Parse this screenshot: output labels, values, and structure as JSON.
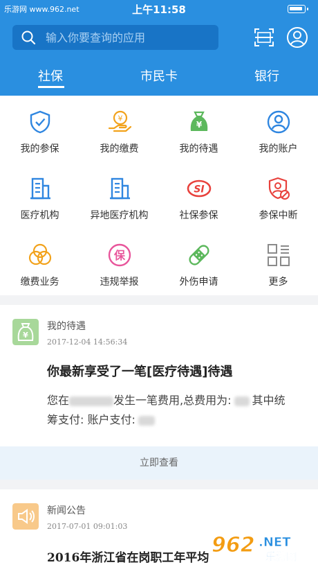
{
  "status_bar": {
    "watermark": "乐游网 www.962.net",
    "time": "上午11:58"
  },
  "search": {
    "placeholder": "输入你要查询的应用"
  },
  "tabs": [
    {
      "label": "社保",
      "active": true
    },
    {
      "label": "市民卡",
      "active": false
    },
    {
      "label": "银行",
      "active": false
    }
  ],
  "grid": {
    "items": [
      {
        "label": "我的参保",
        "icon": "shield-check-icon"
      },
      {
        "label": "我的缴费",
        "icon": "hand-coin-icon"
      },
      {
        "label": "我的待遇",
        "icon": "money-bag-icon"
      },
      {
        "label": "我的账户",
        "icon": "user-circle-icon"
      },
      {
        "label": "医疗机构",
        "icon": "building-icon"
      },
      {
        "label": "异地医疗机构",
        "icon": "building-icon"
      },
      {
        "label": "社保参保",
        "icon": "si-logo-icon"
      },
      {
        "label": "参保中断",
        "icon": "shield-user-block-icon"
      },
      {
        "label": "缴费业务",
        "icon": "venn-circles-icon"
      },
      {
        "label": "违规举报",
        "icon": "report-seal-icon"
      },
      {
        "label": "外伤申请",
        "icon": "bandage-icon"
      },
      {
        "label": "更多",
        "icon": "grid-more-icon"
      }
    ]
  },
  "colors": {
    "header": "#2a8fe0",
    "icon_blue": "#2f86e0",
    "icon_orange": "#f2a21b",
    "icon_green": "#5cb85c",
    "icon_red": "#e8413c",
    "icon_pink": "#e8559b",
    "icon_gray": "#8a8a8a"
  },
  "cards": [
    {
      "category": "我的待遇",
      "date": "2017-12-04 14:56:34",
      "title": "你最新享受了一笔[医疗待遇]待遇",
      "line1_prefix": "您在",
      "line1_mid": "发生一笔费用,总费用为:",
      "line1_suffix": "其中统",
      "line2": "筹支付: 账户支付:",
      "action": "立即查看"
    },
    {
      "category": "新闻公告",
      "date": "2017-07-01 09:01:03",
      "title": "2016年浙江省在岗职工年平均"
    }
  ],
  "brand": {
    "logo_text": "962",
    "logo_sub": "乐游网",
    "logo_net": ".NET"
  }
}
